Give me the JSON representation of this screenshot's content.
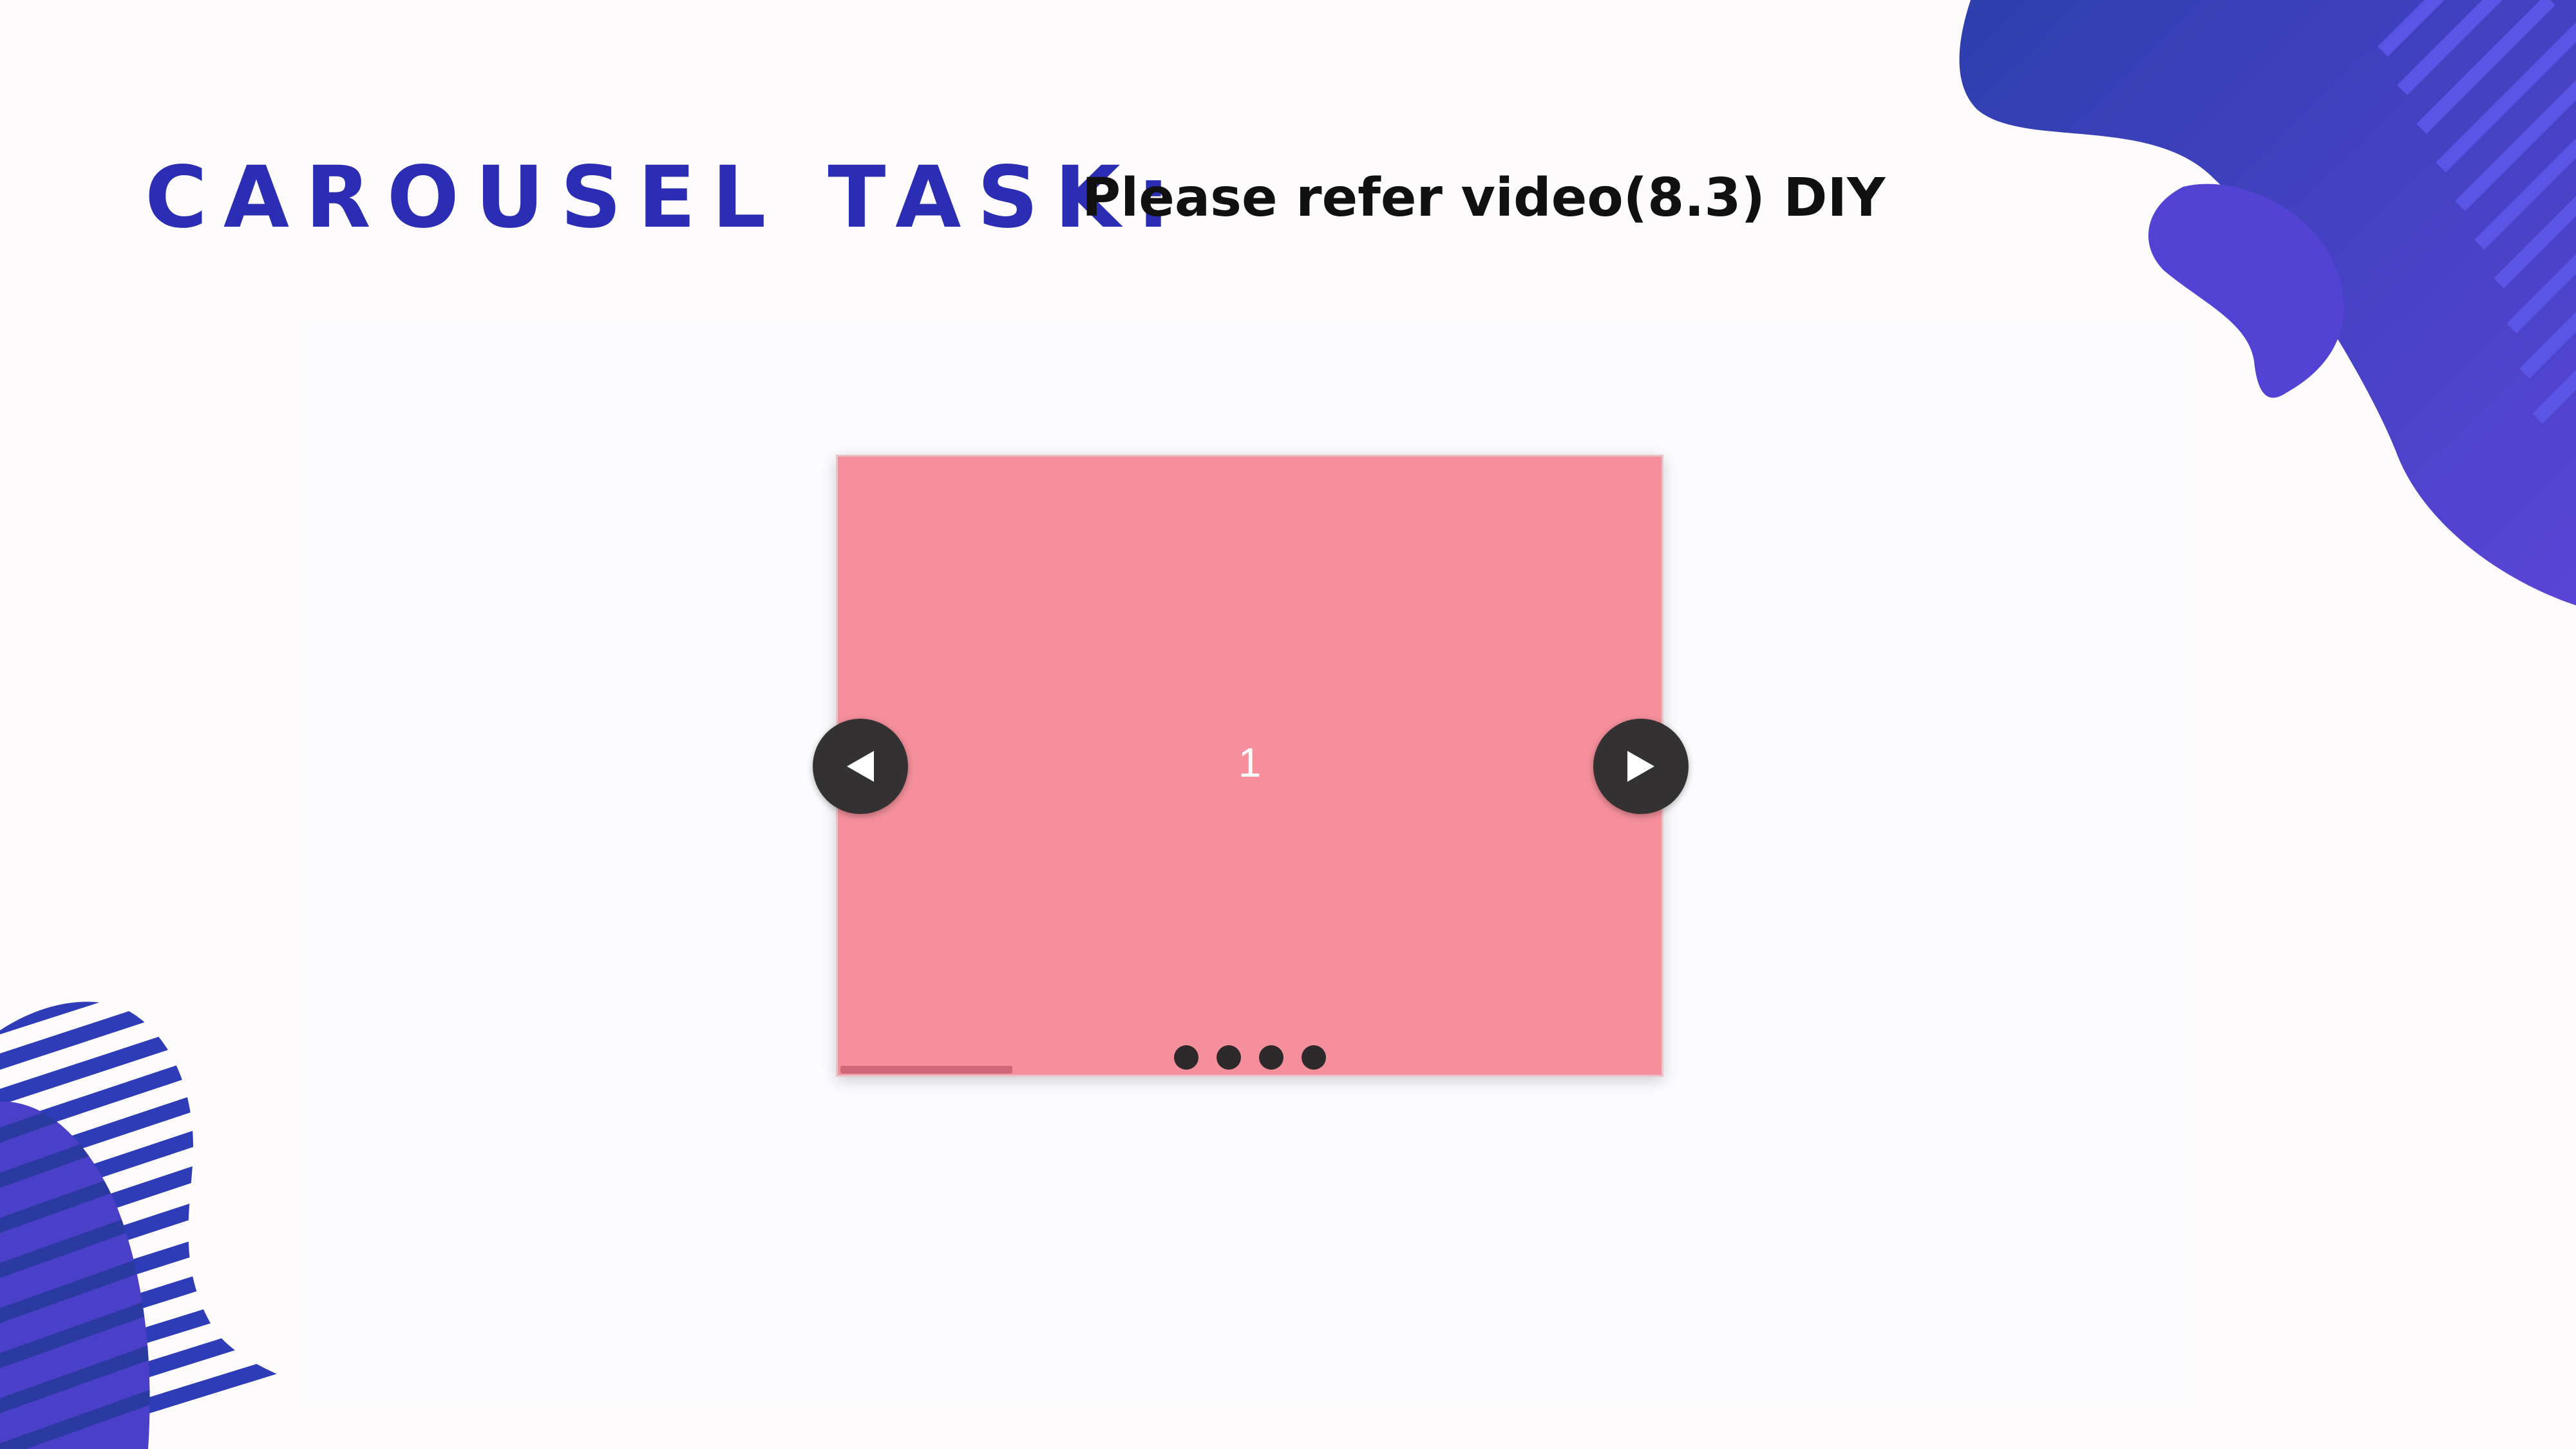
{
  "header": {
    "title": "CAROUSEL TASK:",
    "subtitle": "Please refer video(8.3) DIY"
  },
  "carousel": {
    "current_slide_label": "1",
    "slide_count": 4,
    "active_index": 0,
    "slide_color": "#f48f9b",
    "autoplay_progress": 0.21,
    "prev_icon": "triangle-left-icon",
    "next_icon": "triangle-right-icon"
  },
  "colors": {
    "accent": "#2c2db5",
    "decor_blue": "#3a3cc4",
    "decor_dark": "#2a3aa0",
    "nav_button": "#333131"
  }
}
